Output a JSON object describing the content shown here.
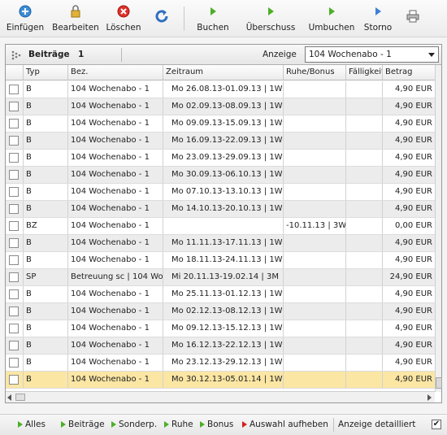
{
  "toolbar": {
    "einfuegen": "Einfügen",
    "bearbeiten": "Bearbeiten",
    "loeschen": "Löschen",
    "buchen": "Buchen",
    "ueberschuss": "Überschuss",
    "umbuchen": "Umbuchen",
    "storno": "Storno"
  },
  "panel": {
    "title": "Beiträge",
    "count": "1",
    "anzeige_label": "Anzeige",
    "anzeige_value": "104 Wochenabo - 1"
  },
  "columns": [
    "Typ",
    "Bez.",
    "Zeitraum",
    "Ruhe/Bonus",
    "Fälligkeit",
    "Betrag"
  ],
  "rows": [
    {
      "typ": "B",
      "bez": "104 Wochenabo - 1",
      "zeitraum": "Mo 26.08.13-01.09.13 | 1W",
      "ruhe": "",
      "faellig": "",
      "betrag": "4,90 EUR"
    },
    {
      "typ": "B",
      "bez": "104 Wochenabo - 1",
      "zeitraum": "Mo 02.09.13-08.09.13 | 1W",
      "ruhe": "",
      "faellig": "",
      "betrag": "4,90 EUR"
    },
    {
      "typ": "B",
      "bez": "104 Wochenabo - 1",
      "zeitraum": "Mo 09.09.13-15.09.13 | 1W",
      "ruhe": "",
      "faellig": "",
      "betrag": "4,90 EUR"
    },
    {
      "typ": "B",
      "bez": "104 Wochenabo - 1",
      "zeitraum": "Mo 16.09.13-22.09.13 | 1W",
      "ruhe": "",
      "faellig": "",
      "betrag": "4,90 EUR"
    },
    {
      "typ": "B",
      "bez": "104 Wochenabo - 1",
      "zeitraum": "Mo 23.09.13-29.09.13 | 1W",
      "ruhe": "",
      "faellig": "",
      "betrag": "4,90 EUR"
    },
    {
      "typ": "B",
      "bez": "104 Wochenabo - 1",
      "zeitraum": "Mo 30.09.13-06.10.13 | 1W",
      "ruhe": "",
      "faellig": "",
      "betrag": "4,90 EUR"
    },
    {
      "typ": "B",
      "bez": "104 Wochenabo - 1",
      "zeitraum": "Mo 07.10.13-13.10.13 | 1W",
      "ruhe": "",
      "faellig": "",
      "betrag": "4,90 EUR"
    },
    {
      "typ": "B",
      "bez": "104 Wochenabo - 1",
      "zeitraum": "Mo 14.10.13-20.10.13 | 1W",
      "ruhe": "",
      "faellig": "",
      "betrag": "4,90 EUR"
    },
    {
      "typ": "BZ",
      "bez": "104 Wochenabo - 1",
      "zeitraum": "",
      "ruhe": "-10.11.13 | 3W",
      "faellig": "",
      "betrag": "0,00 EUR"
    },
    {
      "typ": "B",
      "bez": "104 Wochenabo - 1",
      "zeitraum": "Mo 11.11.13-17.11.13 | 1W",
      "ruhe": "",
      "faellig": "",
      "betrag": "4,90 EUR"
    },
    {
      "typ": "B",
      "bez": "104 Wochenabo - 1",
      "zeitraum": "Mo 18.11.13-24.11.13 | 1W",
      "ruhe": "",
      "faellig": "",
      "betrag": "4,90 EUR"
    },
    {
      "typ": "SP",
      "bez": "Betreuung sc | 104 Wo",
      "zeitraum": "Mi 20.11.13-19.02.14 | 3M",
      "ruhe": "",
      "faellig": "",
      "betrag": "24,90 EUR"
    },
    {
      "typ": "B",
      "bez": "104 Wochenabo - 1",
      "zeitraum": "Mo 25.11.13-01.12.13 | 1W",
      "ruhe": "",
      "faellig": "",
      "betrag": "4,90 EUR"
    },
    {
      "typ": "B",
      "bez": "104 Wochenabo - 1",
      "zeitraum": "Mo 02.12.13-08.12.13 | 1W",
      "ruhe": "",
      "faellig": "",
      "betrag": "4,90 EUR"
    },
    {
      "typ": "B",
      "bez": "104 Wochenabo - 1",
      "zeitraum": "Mo 09.12.13-15.12.13 | 1W",
      "ruhe": "",
      "faellig": "",
      "betrag": "4,90 EUR"
    },
    {
      "typ": "B",
      "bez": "104 Wochenabo - 1",
      "zeitraum": "Mo 16.12.13-22.12.13 | 1W",
      "ruhe": "",
      "faellig": "",
      "betrag": "4,90 EUR"
    },
    {
      "typ": "B",
      "bez": "104 Wochenabo - 1",
      "zeitraum": "Mo 23.12.13-29.12.13 | 1W",
      "ruhe": "",
      "faellig": "",
      "betrag": "4,90 EUR"
    },
    {
      "typ": "B",
      "bez": "104 Wochenabo - 1",
      "zeitraum": "Mo 30.12.13-05.01.14 | 1W",
      "ruhe": "",
      "faellig": "",
      "betrag": "4,90 EUR",
      "selected": true
    }
  ],
  "bottom": {
    "alles": "Alles",
    "beitraege": "Beiträge",
    "sonderp": "Sonderp.",
    "ruhe": "Ruhe",
    "bonus": "Bonus",
    "auswahl": "Auswahl aufheben",
    "detailliert": "Anzeige detailliert",
    "detailliert_checked": true
  },
  "colors": {
    "selected_row": "#fbe6a4",
    "alt_row": "#ececec",
    "green": "#4caf26",
    "red": "#d41f1f",
    "blue": "#3d7fd6"
  }
}
